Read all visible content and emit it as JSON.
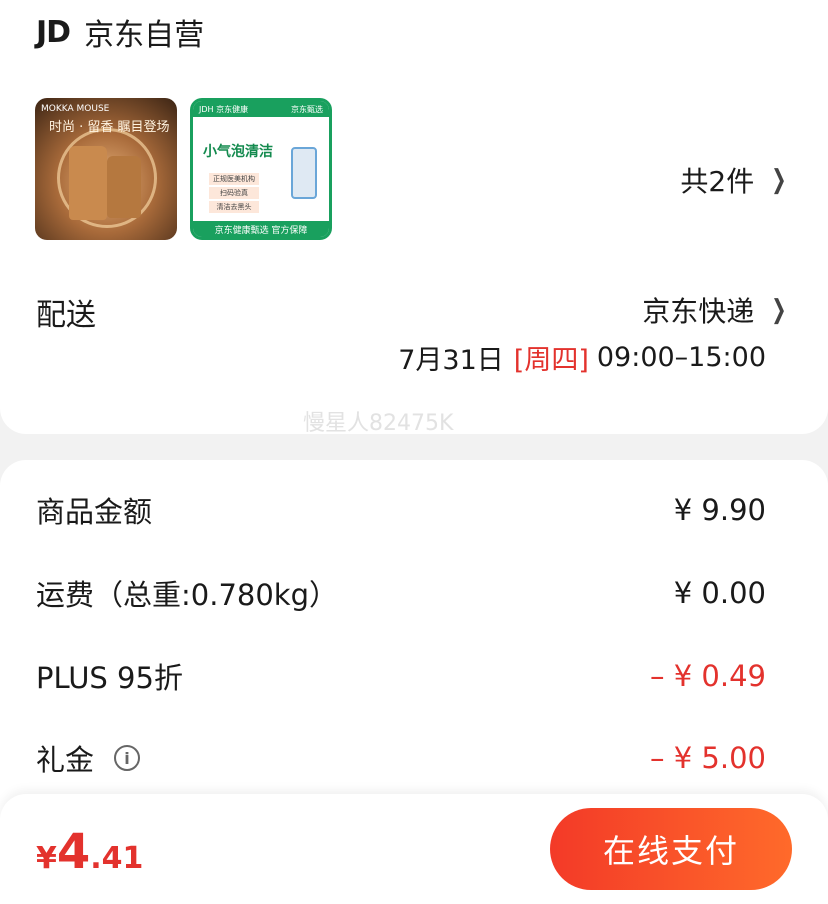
{
  "store": {
    "logo": "JD",
    "name": "京东自营"
  },
  "products": {
    "item1": {
      "brand": "MOKKA\nMOUSE",
      "slogan": "时尚 · 留香 瞩目登场"
    },
    "item2": {
      "top_left": "JDH 京东健康",
      "top_right": "京东甄选",
      "headline": "小气泡清洁",
      "tags": [
        "正规医美机构",
        "扫码验真",
        "清洁去黑头"
      ],
      "bottom": "京东健康甄选 官方保障"
    },
    "count_label": "共2件"
  },
  "delivery": {
    "label": "配送",
    "method": "京东快递",
    "date": "7月31日",
    "weekday": "[周四]",
    "time": "09:00–15:00"
  },
  "watermark": "慢星人82475K",
  "fees": [
    {
      "label": "商品金额",
      "value": "¥ 9.90"
    },
    {
      "label": "运费（总重:0.780kg）",
      "value": "¥ 0.00"
    },
    {
      "label": "PLUS 95折",
      "value": "– ¥ 0.49"
    },
    {
      "label": "礼金",
      "value": "– ¥ 5.00"
    }
  ],
  "footer": {
    "currency": "¥",
    "total_int": "4",
    "total_dec": ".41",
    "pay_label": "在线支付"
  },
  "colors": {
    "accent_red": "#e3322d",
    "jd_green": "#19a05e"
  }
}
